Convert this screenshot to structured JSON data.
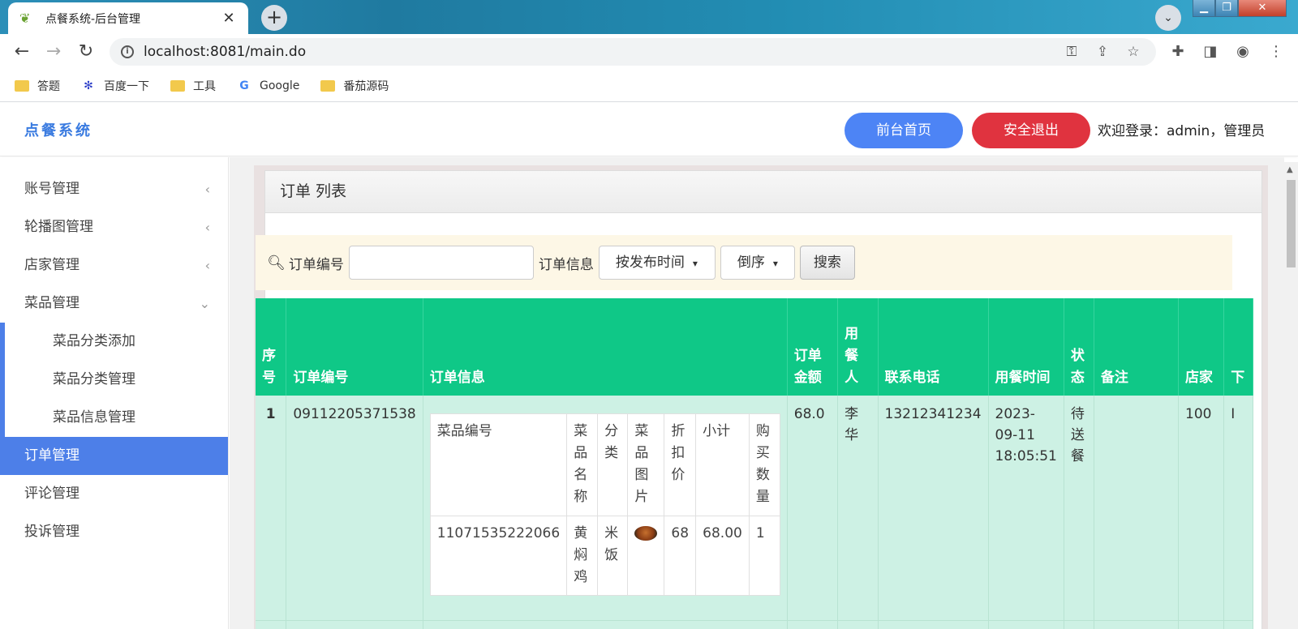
{
  "browser": {
    "tab_title": "点餐系统-后台管理",
    "tab_close": "✕",
    "new_tab": "+",
    "url": "localhost:8081/main.do",
    "bookmarks": [
      "答题",
      "百度一下",
      "工具",
      "Google",
      "番茄源码"
    ]
  },
  "header": {
    "brand": "点餐系统",
    "front_button": "前台首页",
    "logout_button": "安全退出",
    "welcome": "欢迎登录：admin，管理员"
  },
  "sidebar": {
    "items": [
      {
        "label": "账号管理"
      },
      {
        "label": "轮播图管理"
      },
      {
        "label": "店家管理"
      },
      {
        "label": "菜品管理"
      }
    ],
    "sub_items": [
      "菜品分类添加",
      "菜品分类管理",
      "菜品信息管理"
    ],
    "bottom_items": [
      "订单管理",
      "评论管理",
      "投诉管理"
    ],
    "active": "订单管理"
  },
  "panel": {
    "title": "订单 列表"
  },
  "search": {
    "label_order_no": "订单编号",
    "order_no_value": "",
    "label_order_info": "订单信息",
    "sort_field": "按发布时间",
    "sort_order": "倒序",
    "button": "搜索"
  },
  "table": {
    "headers": [
      "序号",
      "订单编号",
      "订单信息",
      "订单金额",
      "用餐人",
      "联系电话",
      "用餐时间",
      "状态",
      "备注",
      "店家",
      "下"
    ],
    "rows": [
      {
        "index": "1",
        "order_no": "09112205371538",
        "amount": "68.0",
        "diner": "李华",
        "phone": "13212341234",
        "time": "2023-09-11 18:05:51",
        "status": "待送餐",
        "remark": "",
        "shop": "100",
        "extra": "I"
      }
    ],
    "inner_headers": [
      "菜品编号",
      "菜品名称",
      "分类",
      "菜品图片",
      "折扣价",
      "小计",
      "购买数量"
    ],
    "inner_rows": [
      {
        "dish_no": "11071535222066",
        "dish_name": "黄焖鸡",
        "category": "米饭",
        "image": "dish-photo",
        "discount": "68",
        "subtotal": "68.00",
        "qty": "1"
      }
    ]
  },
  "colors": {
    "accent": "#4d7fe8",
    "danger": "#e0333f",
    "table_header": "#0fc887",
    "table_row": "#cdf1e4",
    "search_bg": "#fdf7e6"
  }
}
